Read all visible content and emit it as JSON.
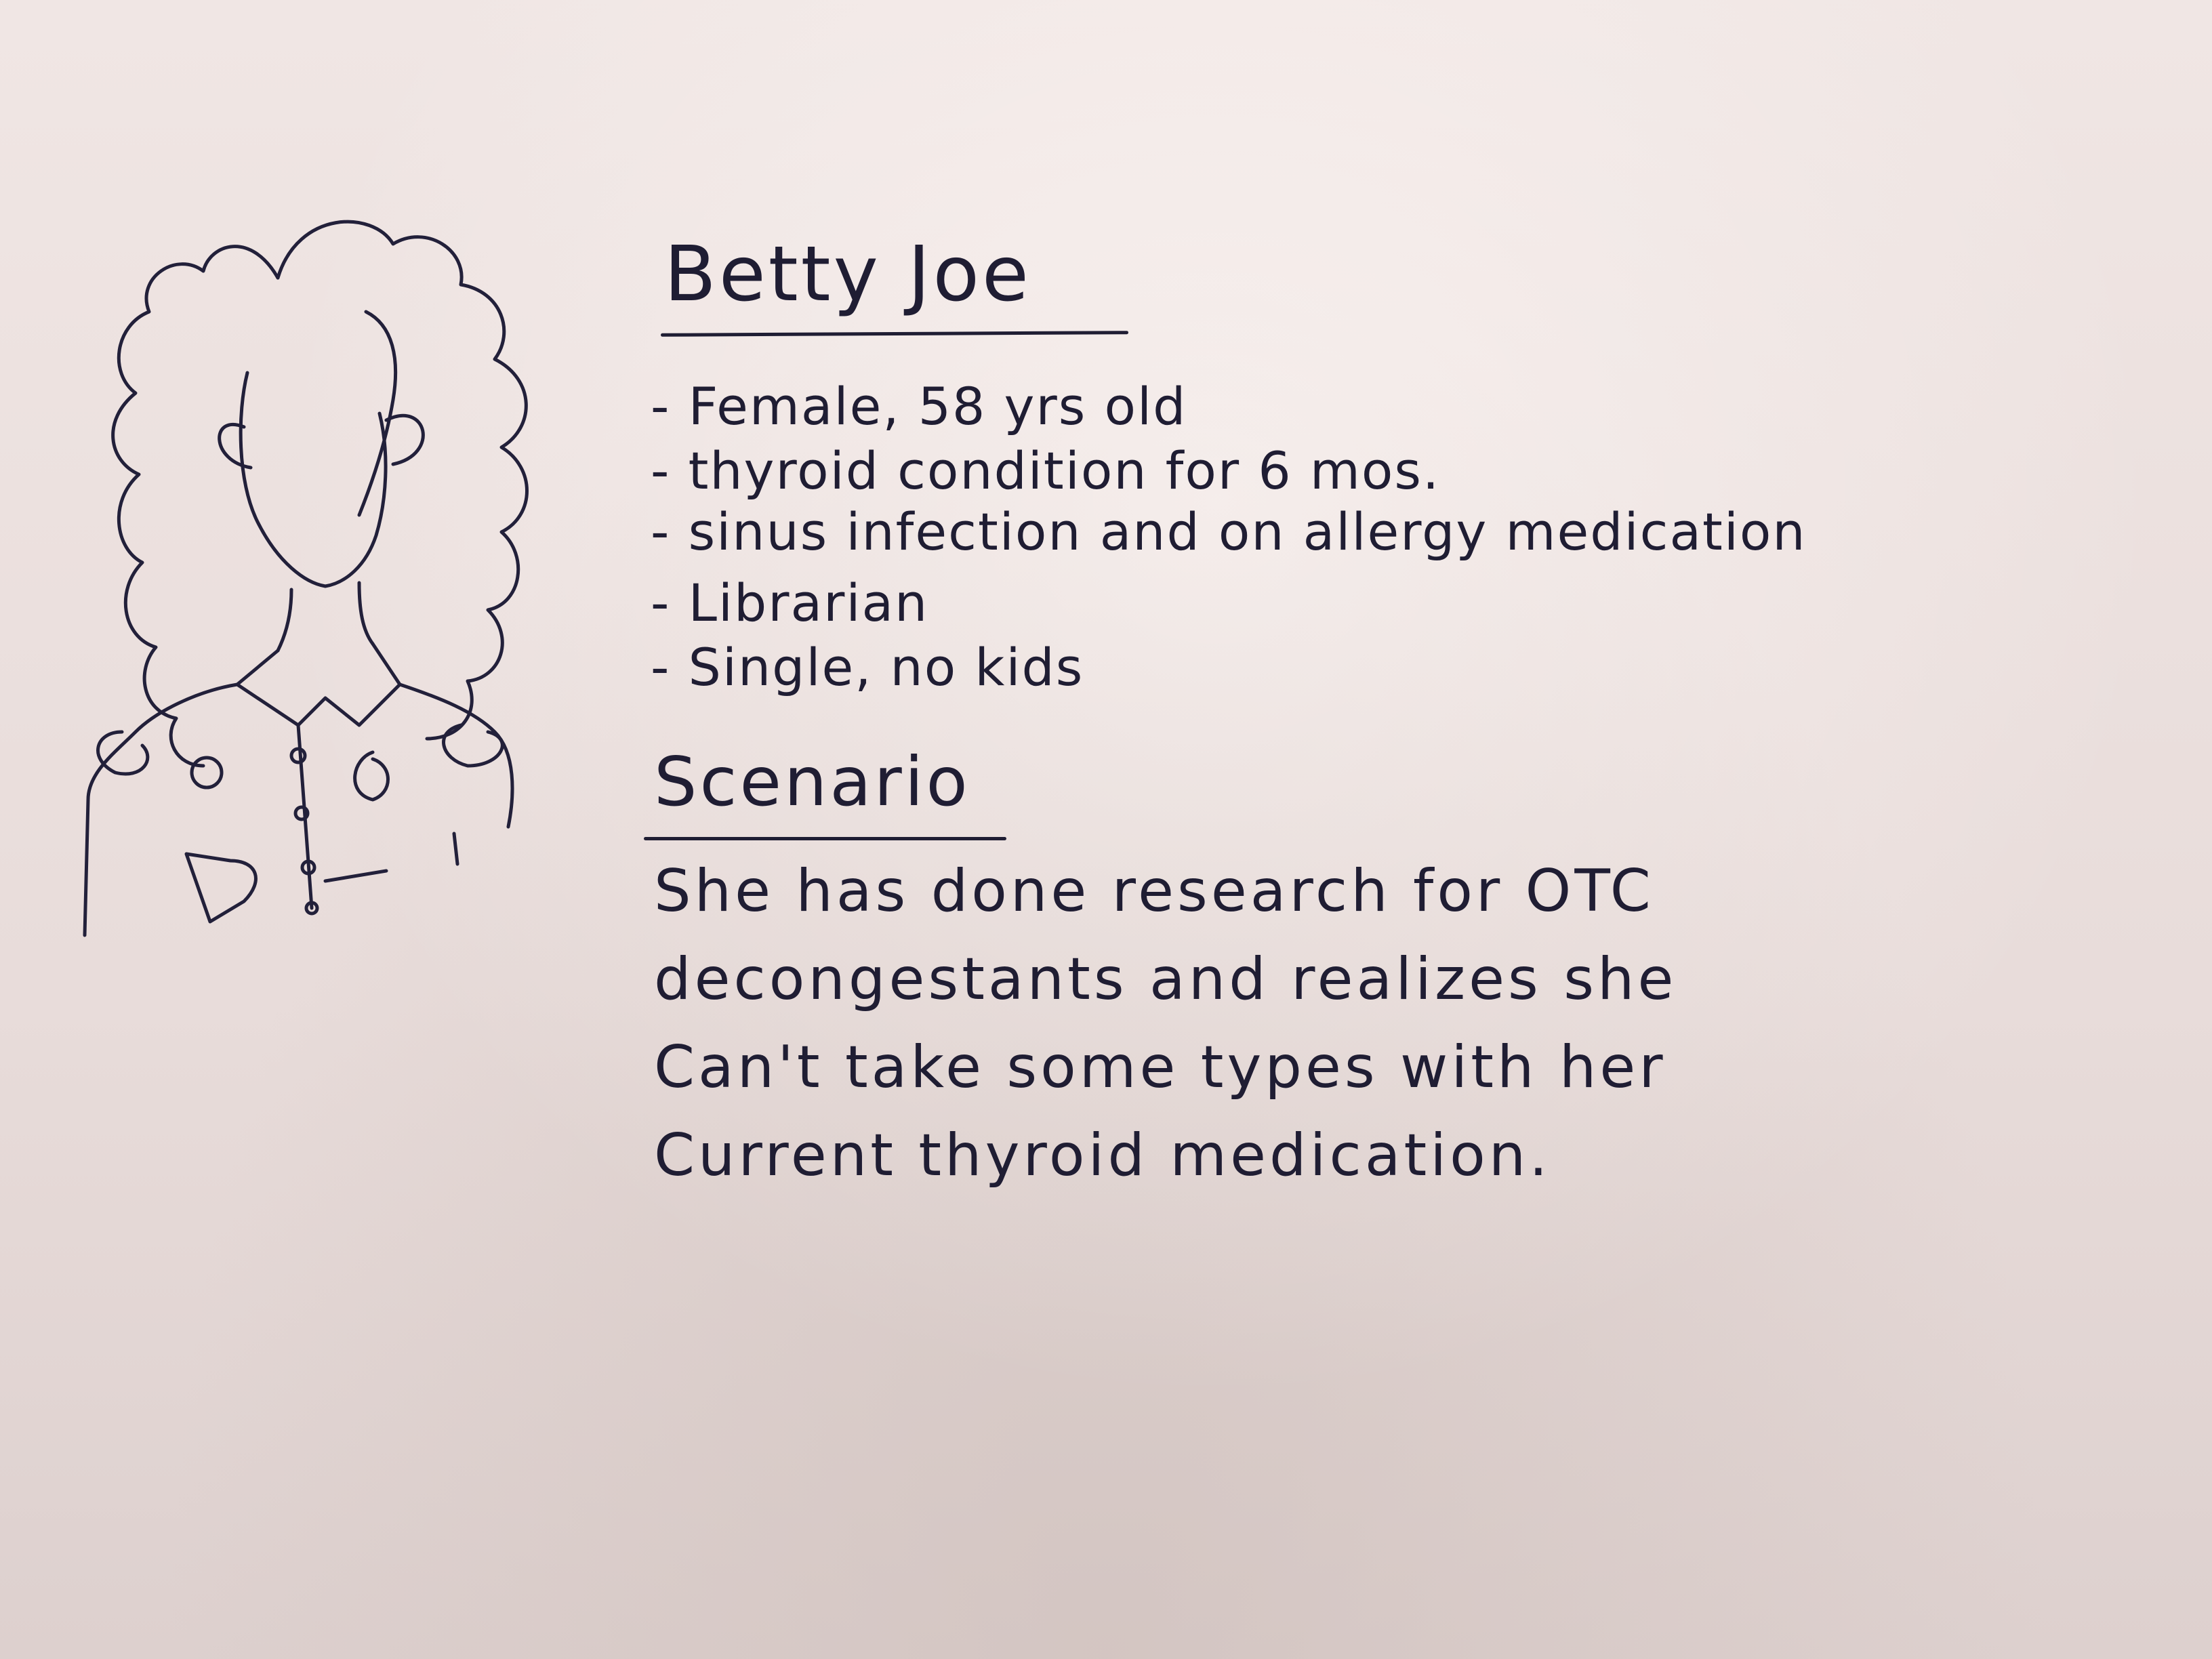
{
  "persona": {
    "name": "Betty Joe",
    "profile": [
      "- Female, 58 yrs old",
      "- thyroid condition for 6 mos.",
      "- sinus infection and on allergy medication",
      "- Librarian",
      "- Single, no kids"
    ]
  },
  "scenario": {
    "heading": "Scenario",
    "lines": [
      "She has done research for OTC",
      "decongestants and realizes she",
      "Can't take some types with her",
      "Current thyroid medication."
    ]
  },
  "colors": {
    "paper": "#ece1df",
    "ink": "#1f1d33"
  }
}
